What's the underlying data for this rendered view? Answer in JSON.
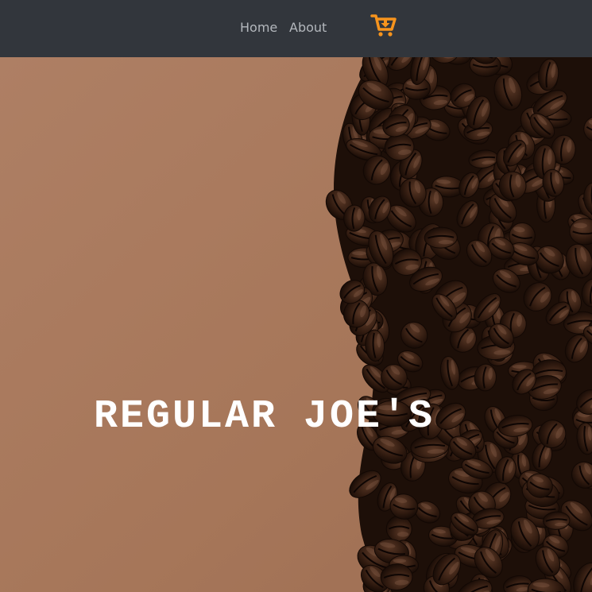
{
  "nav": {
    "links": [
      {
        "label": "Home"
      },
      {
        "label": "About"
      }
    ],
    "cart_icon": "cart-download-icon",
    "cart_color": "#f7941d",
    "background": "#32363c"
  },
  "hero": {
    "title": "REGULAR JOE'S",
    "background_image": "coffee-beans-on-brown-paper",
    "paper_color": "#a97a5f"
  }
}
